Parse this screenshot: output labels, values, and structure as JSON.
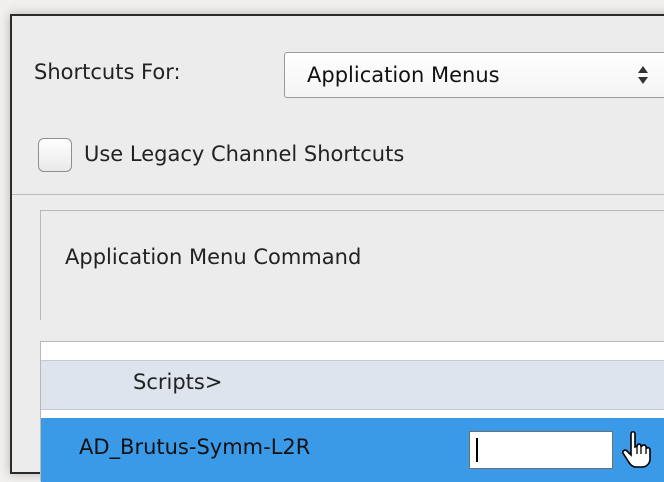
{
  "shortcuts": {
    "label": "Shortcuts For:",
    "selected": "Application Menus"
  },
  "legacy": {
    "label": "Use Legacy Channel Shortcuts",
    "checked": false
  },
  "table": {
    "column_header": "Application Menu Command",
    "rows": [
      {
        "label": "Scripts>",
        "kind": "group"
      },
      {
        "label": "AD_Brutus-Symm-L2R",
        "kind": "item",
        "selected": true,
        "shortcut_value": ""
      }
    ]
  },
  "colors": {
    "selection": "#3a9ae8",
    "group_row": "#dde4ee",
    "panel": "#ececec"
  },
  "icons": {
    "dropdown": "updown-arrows-icon",
    "cursor": "hand-pointer-icon"
  }
}
